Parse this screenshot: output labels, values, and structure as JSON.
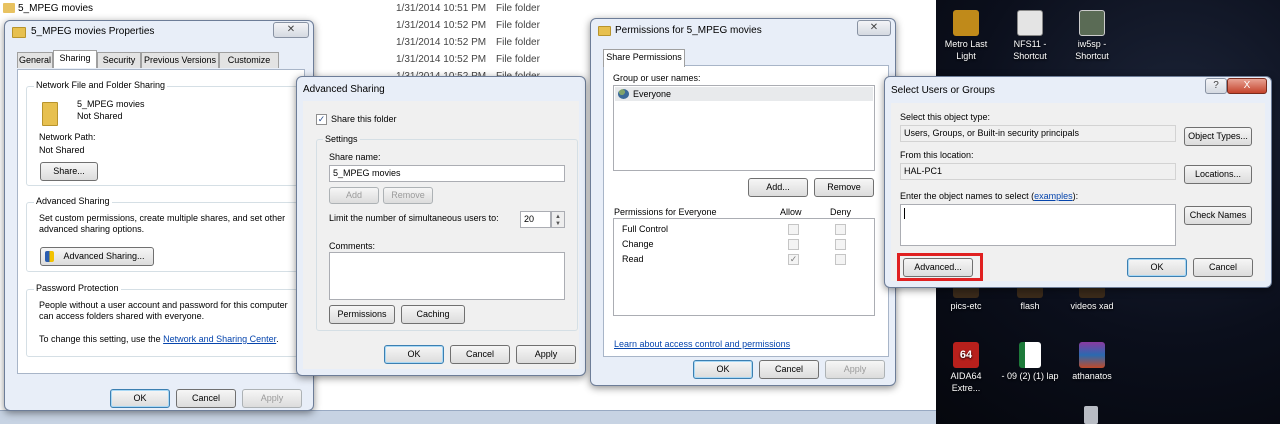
{
  "explorer": {
    "rows": [
      {
        "name": "5_MPEG movies",
        "date": "1/31/2014 10:51 PM",
        "type": "File folder"
      },
      {
        "name": "",
        "date": "1/31/2014 10:52 PM",
        "type": "File folder"
      },
      {
        "name": "",
        "date": "1/31/2014 10:52 PM",
        "type": "File folder"
      },
      {
        "name": "",
        "date": "1/31/2014 10:52 PM",
        "type": "File folder"
      },
      {
        "name": "",
        "date": "1/31/2014 10:52 PM",
        "type": "File folder"
      }
    ]
  },
  "desktop": {
    "icons": [
      {
        "label": "Metro Last Light"
      },
      {
        "label": "NFS11 - Shortcut"
      },
      {
        "label": "iw5sp - Shortcut"
      },
      {
        "label": "pics-etc"
      },
      {
        "label": "flash"
      },
      {
        "label": "videos xad"
      },
      {
        "label": "AIDA64 Extre..."
      },
      {
        "label": "- 09 (2) (1) lap"
      },
      {
        "label": "athanatos"
      }
    ]
  },
  "properties": {
    "title": "5_MPEG movies Properties",
    "tabs": [
      "General",
      "Sharing",
      "Security",
      "Previous Versions",
      "Customize"
    ],
    "network_group": "Network File and Folder Sharing",
    "folder_name": "5_MPEG movies",
    "folder_status": "Not Shared",
    "network_path_label": "Network Path:",
    "network_path_value": "Not Shared",
    "share_button": "Share...",
    "advanced_group": "Advanced Sharing",
    "advanced_desc": "Set custom permissions, create multiple shares, and set other advanced sharing options.",
    "advanced_button": "Advanced Sharing...",
    "password_group": "Password Protection",
    "password_desc": "People without a user account and password for this computer can access folders shared with everyone.",
    "password_change_prefix": "To change this setting, use the ",
    "password_link": "Network and Sharing Center",
    "password_change_suffix": ".",
    "ok": "OK",
    "cancel": "Cancel",
    "apply": "Apply"
  },
  "advanced": {
    "title": "Advanced Sharing",
    "share_checkbox": "Share this folder",
    "share_checked": true,
    "settings_group": "Settings",
    "share_name_label": "Share name:",
    "share_name_value": "5_MPEG movies",
    "add": "Add",
    "remove": "Remove",
    "limit_label": "Limit the number of simultaneous users to:",
    "limit_value": "20",
    "comments_label": "Comments:",
    "permissions": "Permissions",
    "caching": "Caching",
    "ok": "OK",
    "cancel": "Cancel",
    "apply": "Apply"
  },
  "permissions": {
    "title": "Permissions for 5_MPEG movies",
    "tab": "Share Permissions",
    "group_label": "Group or user names:",
    "users": [
      "Everyone"
    ],
    "add": "Add...",
    "remove": "Remove",
    "perm_header": "Permissions for Everyone",
    "allow_header": "Allow",
    "deny_header": "Deny",
    "rows": [
      {
        "name": "Full Control",
        "allow": false,
        "deny": false
      },
      {
        "name": "Change",
        "allow": false,
        "deny": false
      },
      {
        "name": "Read",
        "allow": true,
        "deny": false
      }
    ],
    "learn_link": "Learn about access control and permissions",
    "ok": "OK",
    "cancel": "Cancel",
    "apply": "Apply"
  },
  "select_users": {
    "title": "Select Users or Groups",
    "help": "?",
    "close": "X",
    "object_type_label": "Select this object type:",
    "object_type_value": "Users, Groups, or Built-in security principals",
    "object_types_button": "Object Types...",
    "location_label": "From this location:",
    "location_value": "HAL-PC1",
    "locations_button": "Locations...",
    "enter_label_prefix": "Enter the object names to select (",
    "enter_label_link": "examples",
    "enter_label_suffix": "):",
    "check_names": "Check Names",
    "advanced_button": "Advanced...",
    "highlight_color": "#e02020",
    "ok": "OK",
    "cancel": "Cancel"
  }
}
